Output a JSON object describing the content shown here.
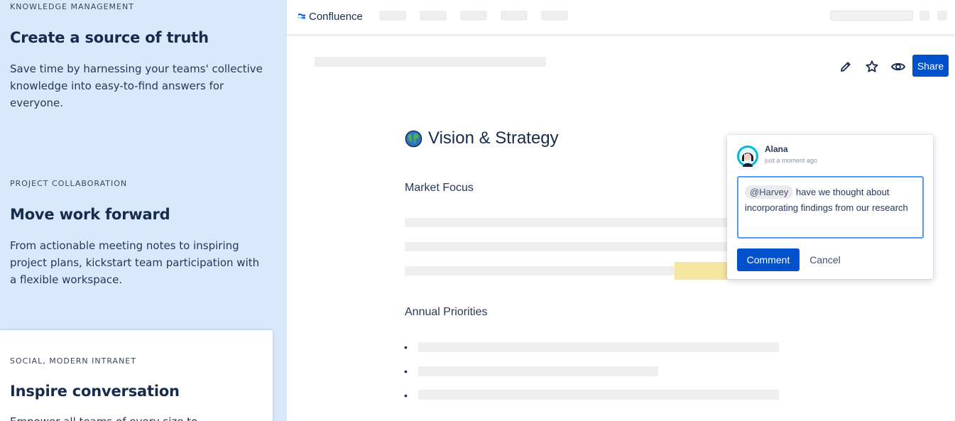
{
  "left_panel": {
    "features": [
      {
        "eyebrow": "KNOWLEDGE MANAGEMENT",
        "title": "Create a source of truth",
        "description": "Save time by harnessing your teams' collective knowledge into easy-to-find answers for everyone."
      },
      {
        "eyebrow": "PROJECT COLLABORATION",
        "title": "Move work forward",
        "description": "From actionable meeting notes to inspiring project plans, kickstart team participation with a flexible workspace."
      },
      {
        "eyebrow": "SOCIAL, MODERN INTRANET",
        "title": "Inspire conversation",
        "description": "Empower all teams of every size to..."
      }
    ],
    "active_index": 2
  },
  "app": {
    "logo_text": "Confluence",
    "logo_icon": "confluence-logo-icon",
    "accent": "#0052cc",
    "toolbar": {
      "edit_icon": "pencil-icon",
      "star_icon": "star-icon",
      "watch_icon": "eye-icon",
      "share_label": "Share"
    },
    "page": {
      "emoji_icon": "globe-icon",
      "title": "Vision & Strategy",
      "section1": "Market Focus",
      "section2": "Annual Priorities",
      "bullet": "•"
    },
    "comment": {
      "user": "Alana",
      "timestamp": "just a moment ago",
      "mention": "@Harvey",
      "text": " have we thought about incorporating findings from our research",
      "submit_label": "Comment",
      "cancel_label": "Cancel"
    }
  }
}
